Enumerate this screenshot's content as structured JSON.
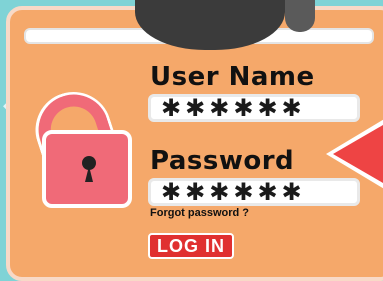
{
  "login": {
    "username_label": "User Name",
    "username_value": "✱✱✱✱✱✱",
    "password_label": "Password",
    "password_value": "✱✱✱✱✱✱",
    "forgot_link": "Forgot password ?",
    "login_button": "LOG IN"
  },
  "colors": {
    "background": "#7fd3d6",
    "card": "#f5a86a",
    "lock": "#f06a78",
    "button": "#e03030",
    "arrow": "#ee4444"
  },
  "icons": {
    "lock": "unlocked-padlock-icon",
    "arrow": "arrow-pointer-icon"
  }
}
